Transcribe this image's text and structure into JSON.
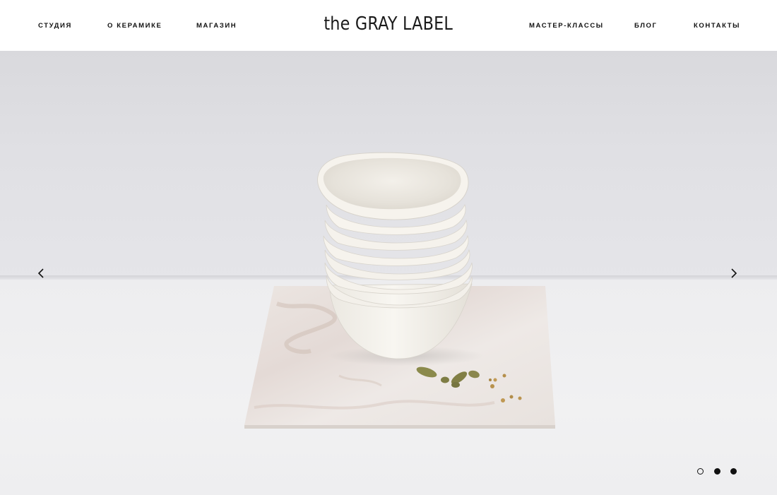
{
  "header": {
    "nav_left": [
      {
        "label": "СТУДИЯ"
      },
      {
        "label": "О КЕРАМИКЕ"
      },
      {
        "label": "МАГАЗИН"
      }
    ],
    "logo": "the GRAY LABEL",
    "nav_right": [
      {
        "label": "МАСТЕР-КЛАССЫ"
      },
      {
        "label": "БЛОГ"
      },
      {
        "label": "КОНТАКТЫ"
      }
    ]
  },
  "slider": {
    "prev_icon": "chevron-left-icon",
    "next_icon": "chevron-right-icon",
    "slide_count": 3,
    "active_slide": 1,
    "image_subject": "stack of white ceramic bowls on marble board with cardamom pods"
  },
  "colors": {
    "text": "#111111",
    "background": "#ffffff",
    "wall": "#e0e0e4",
    "ceramic": "#f6f3ec",
    "marble": "#e9e4df"
  }
}
